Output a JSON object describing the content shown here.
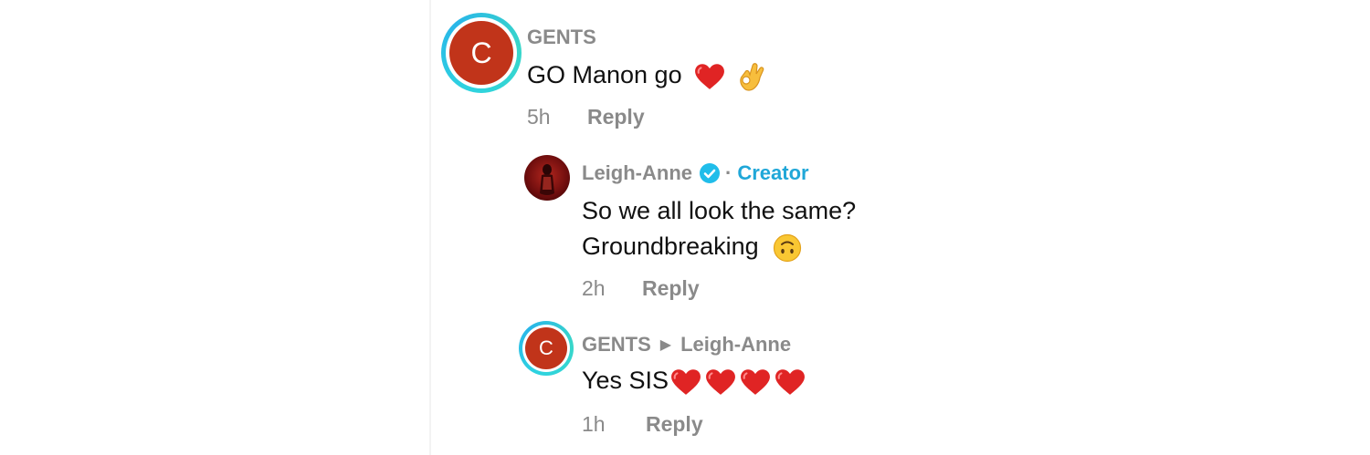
{
  "comments": [
    {
      "avatar_letter": "C",
      "username": "GENTS",
      "text": "GO Manon go",
      "emoji_after": [
        "heart-emoji",
        "ok-hand-emoji"
      ],
      "time": "5h",
      "reply_label": "Reply"
    },
    {
      "username": "Leigh-Anne",
      "separator": "·",
      "creator_label": "Creator",
      "text_line1": "So we all look the same?",
      "text_line2": "Groundbreaking",
      "emoji_after": [
        "upside-down-face-emoji"
      ],
      "time": "2h",
      "reply_label": "Reply"
    },
    {
      "avatar_letter": "C",
      "username": "GENTS",
      "reply_to": "Leigh-Anne",
      "text": "Yes SIS",
      "emoji_after": [
        "heart-emoji",
        "heart-emoji",
        "heart-emoji",
        "heart-emoji"
      ],
      "time": "1h",
      "reply_label": "Reply"
    }
  ],
  "colors": {
    "avatar_bg": "#c1341a",
    "ring": "#2ed3e0",
    "creator": "#20a7d8",
    "heart": "#e02424",
    "muted": "#8a8a8a"
  }
}
